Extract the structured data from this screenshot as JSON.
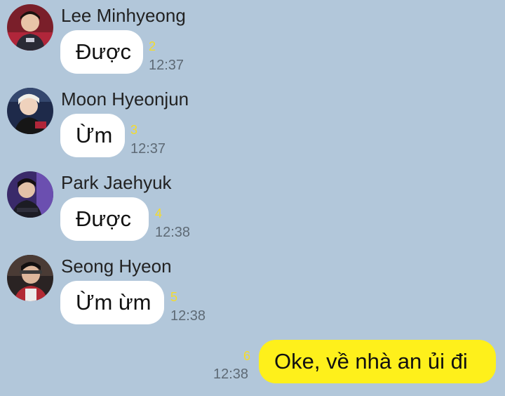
{
  "messages": [
    {
      "sender": "Lee Minhyeong",
      "text": "Được",
      "unread": "2",
      "time": "12:37",
      "avatar": "avatar-lee-minhyeong"
    },
    {
      "sender": "Moon Hyeonjun",
      "text": "Ừm",
      "unread": "3",
      "time": "12:37",
      "avatar": "avatar-moon-hyeonjun"
    },
    {
      "sender": "Park Jaehyuk",
      "text": "Được",
      "unread": "4",
      "time": "12:38",
      "avatar": "avatar-park-jaehyuk"
    },
    {
      "sender": "Seong Hyeon",
      "text": "Ừm ừm",
      "unread": "5",
      "time": "12:38",
      "avatar": "avatar-seong-hyeon"
    }
  ],
  "my_message": {
    "text": "Oke, về nhà an ủi đi",
    "unread": "6",
    "time": "12:38"
  },
  "colors": {
    "background": "#b2c7da",
    "incoming_bubble": "#ffffff",
    "outgoing_bubble": "#fef01b",
    "unread_count": "#f5dc2a",
    "timestamp": "#5e6a75"
  }
}
